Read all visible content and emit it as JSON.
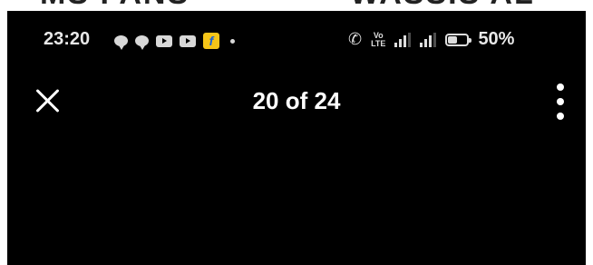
{
  "top_fragment": {
    "left": "MS FANS",
    "right": "WASSIS AL"
  },
  "status_bar": {
    "time": "23:20",
    "notification_icons": [
      "chat-bubble-icon",
      "chat-bubble-icon",
      "youtube-icon",
      "youtube-icon",
      "flipkart-icon"
    ],
    "volte": "Vo\nLTE",
    "battery_percent": "50%",
    "battery_level": 0.5
  },
  "toolbar": {
    "counter": "20 of 24",
    "close_icon": "close-icon",
    "more_icon": "more-vertical-icon"
  },
  "colors": {
    "background": "#000000",
    "text": "#ffffff",
    "accent_flipkart": "#f5c518"
  }
}
